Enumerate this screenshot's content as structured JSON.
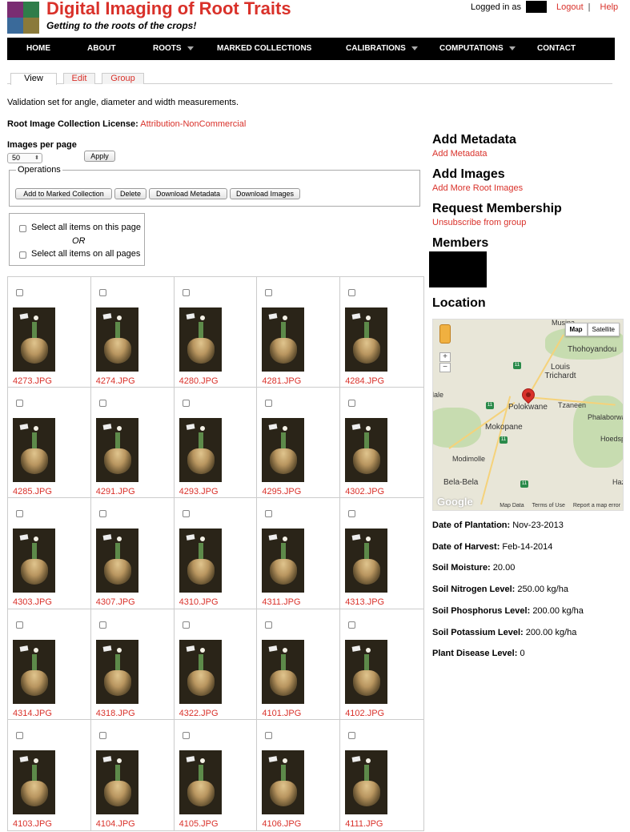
{
  "header": {
    "title": "Digital Imaging of Root Traits",
    "tagline": "Getting to the roots of the crops!",
    "logged_in_as": "Logged in as",
    "logout": "Logout",
    "separator": "|",
    "help": "Help"
  },
  "nav": [
    {
      "label": "Home",
      "dropdown": false
    },
    {
      "label": "About",
      "dropdown": false
    },
    {
      "label": "Roots",
      "dropdown": true
    },
    {
      "label": "Marked Collections",
      "dropdown": false
    },
    {
      "label": "Calibrations",
      "dropdown": true
    },
    {
      "label": "Computations",
      "dropdown": true
    },
    {
      "label": "Contact",
      "dropdown": false
    }
  ],
  "tabs": [
    {
      "label": "View",
      "active": true
    },
    {
      "label": "Edit",
      "active": false
    },
    {
      "label": "Group",
      "active": false
    }
  ],
  "description": "Validation set for angle, diameter and width measurements.",
  "license": {
    "label": "Root Image Collection License:",
    "value": "Attribution-NonCommercial"
  },
  "images_per_page": {
    "label": "Images per page",
    "value": "50",
    "apply": "Apply"
  },
  "operations": {
    "legend": "Operations",
    "buttons": [
      "Add to Marked Collection",
      "Delete",
      "Download Metadata",
      "Download Images"
    ]
  },
  "select": {
    "this_page": "Select all items on this page",
    "or": "OR",
    "all_pages": "Select all items on all pages"
  },
  "images": [
    "4273.JPG",
    "4274.JPG",
    "4280.JPG",
    "4281.JPG",
    "4284.JPG",
    "4285.JPG",
    "4291.JPG",
    "4293.JPG",
    "4295.JPG",
    "4302.JPG",
    "4303.JPG",
    "4307.JPG",
    "4310.JPG",
    "4311.JPG",
    "4313.JPG",
    "4314.JPG",
    "4318.JPG",
    "4322.JPG",
    "4101.JPG",
    "4102.JPG",
    "4103.JPG",
    "4104.JPG",
    "4105.JPG",
    "4106.JPG",
    "4111.JPG"
  ],
  "sidebar": {
    "add_metadata": {
      "heading": "Add Metadata",
      "link": "Add Metadata"
    },
    "add_images": {
      "heading": "Add Images",
      "link": "Add More Root Images"
    },
    "membership": {
      "heading": "Request Membership",
      "link": "Unsubscribe from group"
    },
    "members": {
      "heading": "Members"
    },
    "location": {
      "heading": "Location"
    }
  },
  "map": {
    "map_btn": "Map",
    "satellite_btn": "Satellite",
    "zoom_in": "+",
    "zoom_out": "−",
    "google": "Google",
    "footer": [
      "Map Data",
      "Terms of Use",
      "Report a map error"
    ],
    "places": {
      "musina": "Musina",
      "thohoyandou": "Thohoyandou",
      "louis_trichardt": "Louis Trichardt",
      "polokwane": "Polokwane",
      "tzaneen": "Tzaneen",
      "phalaborwa": "Phalaborwa",
      "mokopane": "Mokopane",
      "hoedspruit": "Hoedspr",
      "modimolle": "Modimolle",
      "bela_bela": "Bela-Bela",
      "ale": "lale",
      "hazy": "Hazy"
    },
    "route_shield": "11"
  },
  "metadata": [
    {
      "label": "Date of Plantation:",
      "value": "Nov-23-2013"
    },
    {
      "label": "Date of Harvest:",
      "value": "Feb-14-2014"
    },
    {
      "label": "Soil Moisture:",
      "value": "20.00"
    },
    {
      "label": "Soil Nitrogen Level:",
      "value": "250.00 kg/ha"
    },
    {
      "label": "Soil Phosphorus Level:",
      "value": "200.00 kg/ha"
    },
    {
      "label": "Soil Potassium Level:",
      "value": "200.00 kg/ha"
    },
    {
      "label": "Plant Disease Level:",
      "value": "0"
    }
  ],
  "colors": {
    "accent": "#d9312a",
    "nav_bg": "#000000"
  }
}
